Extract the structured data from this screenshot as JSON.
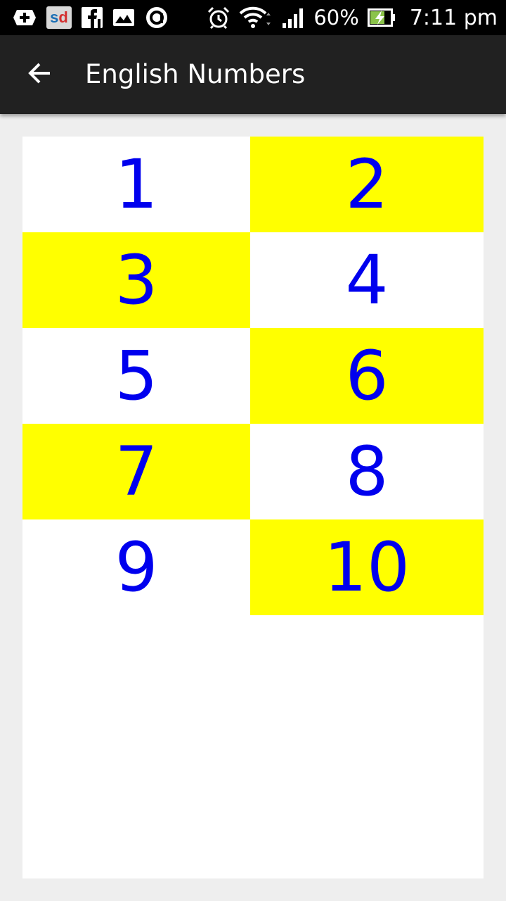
{
  "status_bar": {
    "icons_left": [
      "game-controller-icon",
      "sd-app-icon",
      "facebook-icon",
      "gallery-icon",
      "alert-app-icon"
    ],
    "sd_label": {
      "s": "s",
      "d": "d"
    },
    "battery_percent": "60%",
    "time": "7:11 pm",
    "icons_right": [
      "alarm-icon",
      "wifi-icon",
      "signal-icon",
      "battery-charging-icon"
    ]
  },
  "app_bar": {
    "title": "English Numbers",
    "back_icon": "arrow-back-icon"
  },
  "colors": {
    "number_text": "#0000ee",
    "highlight": "#ffff00",
    "app_bar": "#212121",
    "background": "#eeeeee"
  },
  "numbers": [
    {
      "label": "1",
      "highlight": false
    },
    {
      "label": "2",
      "highlight": true
    },
    {
      "label": "3",
      "highlight": true
    },
    {
      "label": "4",
      "highlight": false
    },
    {
      "label": "5",
      "highlight": false
    },
    {
      "label": "6",
      "highlight": true
    },
    {
      "label": "7",
      "highlight": true
    },
    {
      "label": "8",
      "highlight": false
    },
    {
      "label": "9",
      "highlight": false
    },
    {
      "label": "10",
      "highlight": true
    }
  ]
}
